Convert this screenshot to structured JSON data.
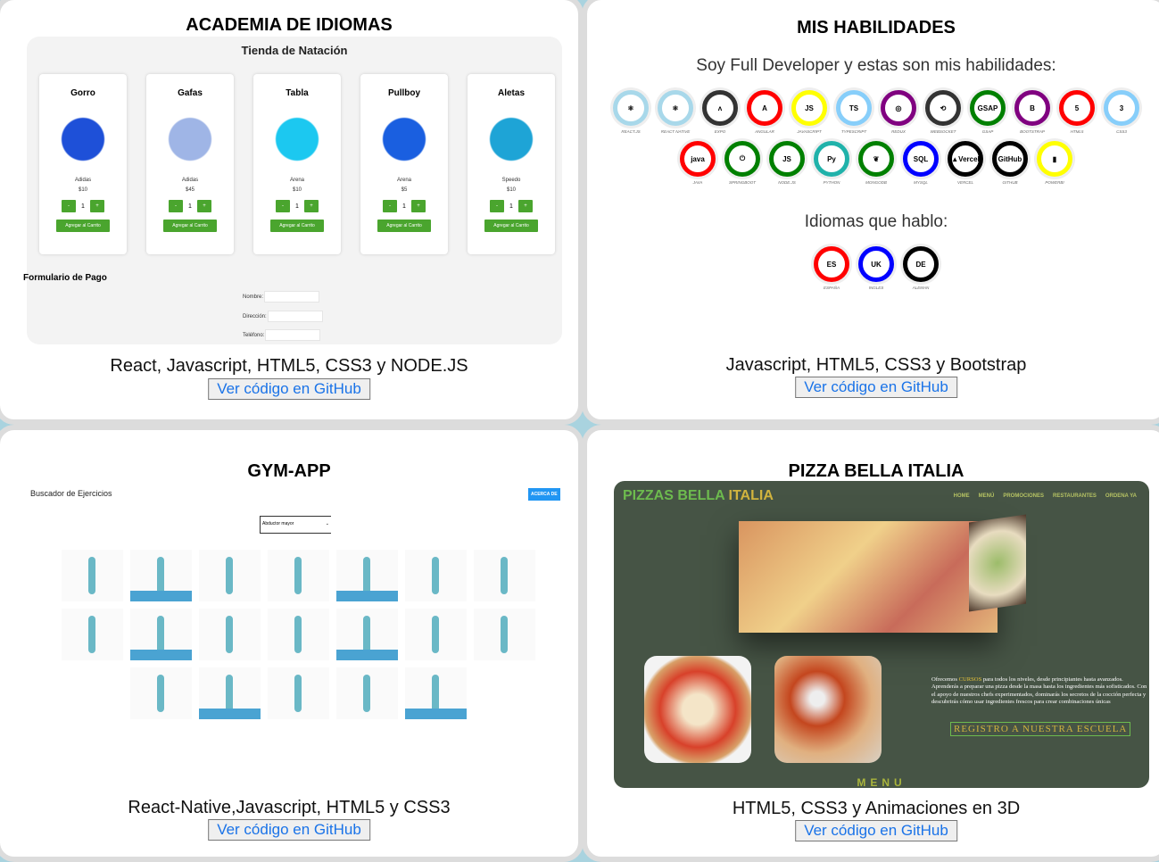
{
  "github_label": "Ver código en GitHub",
  "projects": [
    {
      "title": "ACADEMIA DE IDIOMAS",
      "tech": "React, Javascript, HTML5, CSS3 y NODE.JS",
      "shop": {
        "title": "Tienda de Natación",
        "products": [
          {
            "name": "Gorro",
            "brand": "Adidas",
            "price": "$10",
            "qty": "1",
            "color": "#1e50d8"
          },
          {
            "name": "Gafas",
            "brand": "Adidas",
            "price": "$45",
            "qty": "1",
            "color": "#9fb5e6"
          },
          {
            "name": "Tabla",
            "brand": "Arena",
            "price": "$10",
            "qty": "1",
            "color": "#1cc8f0"
          },
          {
            "name": "Pullboy",
            "brand": "Arena",
            "price": "$5",
            "qty": "1",
            "color": "#1a5fe0"
          },
          {
            "name": "Aletas",
            "brand": "Speedo",
            "price": "$10",
            "qty": "1",
            "color": "#1ea4d6"
          }
        ],
        "minus": "-",
        "plus": "+",
        "add_label": "Agregar al Carrito",
        "form_title": "Formulario de Pago",
        "fields": [
          "Nombre:",
          "Dirección:",
          "Teléfono:"
        ]
      }
    },
    {
      "title": "MIS HABILIDADES",
      "tech": "Javascript, HTML5, CSS3 y Bootstrap",
      "subtitle": "Soy Full Developer y estas son mis habilidades:",
      "skills_row1": [
        {
          "label": "REACT.JS",
          "abbr": "⚛",
          "color": "#a8d8ea"
        },
        {
          "label": "REACT NATIVE",
          "abbr": "⚛",
          "color": "#a8d8ea"
        },
        {
          "label": "EXPO",
          "abbr": "ʌ",
          "color": "#333333"
        },
        {
          "label": "ANGULAR",
          "abbr": "A",
          "color": "#ff0000"
        },
        {
          "label": "JAVASCRIPT",
          "abbr": "JS",
          "color": "#ffff00"
        },
        {
          "label": "TYPESCRIPT",
          "abbr": "TS",
          "color": "#87cefa"
        },
        {
          "label": "REDUX",
          "abbr": "◎",
          "color": "#800080"
        },
        {
          "label": "WEBSOCKET",
          "abbr": "⟲",
          "color": "#333333"
        },
        {
          "label": "GSAP",
          "abbr": "GSAP",
          "color": "#008000"
        },
        {
          "label": "BOOTSTRAP",
          "abbr": "B",
          "color": "#800080"
        },
        {
          "label": "HTML5",
          "abbr": "5",
          "color": "#ff0000"
        },
        {
          "label": "CSS3",
          "abbr": "3",
          "color": "#87cefa"
        }
      ],
      "skills_row2": [
        {
          "label": "JAVA",
          "abbr": "java",
          "color": "#ff0000"
        },
        {
          "label": "SPRINGBOOT",
          "abbr": "⏻",
          "color": "#008000"
        },
        {
          "label": "NODE.JS",
          "abbr": "JS",
          "color": "#008000"
        },
        {
          "label": "PYTHON",
          "abbr": "Py",
          "color": "#20b2aa"
        },
        {
          "label": "MONGODB",
          "abbr": "❦",
          "color": "#008000"
        },
        {
          "label": "MYSQL",
          "abbr": "SQL",
          "color": "#0000ff"
        },
        {
          "label": "VERCEL",
          "abbr": "▲Vercel",
          "color": "#000000"
        },
        {
          "label": "GITHUB",
          "abbr": "GitHub",
          "color": "#000000"
        },
        {
          "label": "POWERBI",
          "abbr": "▮",
          "color": "#ffff00"
        }
      ],
      "languages_title": "Idiomas que hablo:",
      "languages": [
        {
          "label": "ESPAÑA",
          "abbr": "ES",
          "color": "#ff0000"
        },
        {
          "label": "INGLES",
          "abbr": "UK",
          "color": "#0000ff"
        },
        {
          "label": "ALEMAN",
          "abbr": "DE",
          "color": "#000000"
        }
      ]
    },
    {
      "title": "GYM-APP",
      "tech": "React-Native,Javascript, HTML5 y CSS3",
      "app_title": "Buscador de Ejercicios",
      "about_button": "ACERCA DE",
      "select_value": "Abductor mayor",
      "select_arrow": "⌄"
    },
    {
      "title": "PIZZA BELLA ITALIA",
      "tech": "HTML5, CSS3 y Animaciones en 3D",
      "logo_a": "PIZZAS BELLA ",
      "logo_b": "ITALIA",
      "nav": [
        "HOME",
        "MENÚ",
        "PROMOCIONES",
        "RESTAURANTES",
        "ORDENA YA"
      ],
      "text_a": "Ofrecemos ",
      "text_hl": "CURSOS",
      "text_b": " para todos los niveles, desde principiantes hasta avanzados. Aprenderás a preparar una pizza desde la masa hasta los ingredientes más sofisticados. Con el apoyo de nuestros chefs experimentados, dominarás los secretos de la cocción perfecta y descubrirás cómo usar ingredientes frescos para crear combinaciones únicas",
      "register": "REGISTRO A NUESTRA ESCUELA",
      "menu": "MENU"
    }
  ]
}
